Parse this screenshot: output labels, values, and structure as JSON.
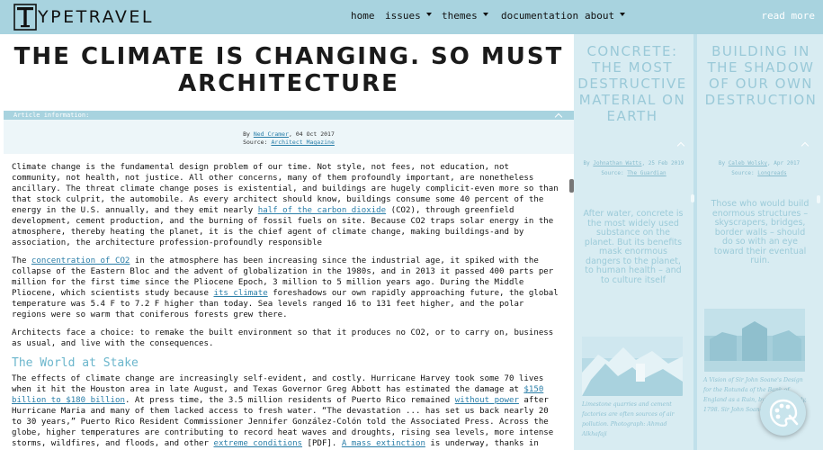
{
  "nav": {
    "brand_initial": "T",
    "brand_rest": "YPETRAVEL",
    "items": [
      {
        "label": "home",
        "dropdown": false
      },
      {
        "label": "issues",
        "dropdown": true
      },
      {
        "label": "themes",
        "dropdown": true
      },
      {
        "label": "documentation",
        "dropdown": false
      },
      {
        "label": "about",
        "dropdown": true
      }
    ],
    "read_more": "read more"
  },
  "article": {
    "title_line1": "THE CLIMATE IS CHANGING. SO MUST",
    "title_line2": "ARCHITECTURE",
    "info_label": "Article information:",
    "by_prefix": "By",
    "author": "Ned Cramer",
    "date": ", 04 Oct 2017",
    "source_prefix": "Source:",
    "source": "Architect Magazine",
    "p1": "Climate change is the fundamental design problem of our time. Not style, not fees, not education, not community, not health, not justice. All other concerns, many of them profoundly important, are nonetheless ancillary. The threat climate change poses is existential, and buildings are hugely complicit-even more so than that stock culprit, the automobile. As every architect should know, buildings consume some 40 percent of the energy in the U.S. annually, and they emit nearly",
    "p1_link": "half of the carbon dioxide",
    "p1_rest": " (CO2), through greenfield development, cement production, and the burning of fossil fuels on site. Because CO2 traps solar energy in the atmosphere, thereby heating the planet, it is the chief agent of climate change, making buildings-and by association, the architecture profession-profoundly responsible",
    "p2_start": "The ",
    "p2_link1": "concentration of CO2",
    "p2_mid": " in the atmosphere has been increasing since the industrial age, it spiked with the collapse of the Eastern Bloc and the advent of globalization in the 1980s, and in 2013 it passed 400 parts per million for the first time since the Pliocene Epoch, 3 million to 5 million years ago. During the Middle Pliocene, which scientists study because ",
    "p2_link2": "its climate",
    "p2_end": " foreshadows our own rapidly approaching future, the global temperature was 5.4 F to 7.2 F higher than today. Sea levels ranged 16 to 131 feet higher, and the polar regions were so warm that coniferous forests grew there.",
    "p3": "Architects face a choice: to remake the built environment so that it produces no CO2, or to carry on, business as usual, and live with the consequences.",
    "h2": "The World at Stake",
    "p4_start": "The effects of climate change are increasingly self-evident, and costly. Hurricane Harvey took some 70 lives when it hit the Houston area in late August, and Texas Governor Greg Abbott has estimated the damage at ",
    "p4_link1": "$150 billion to $180 billion",
    "p4_mid1": ". At press time, the 3.5 million residents of Puerto Rico remained ",
    "p4_link2": "without power",
    "p4_mid2": " after Hurricane Maria and many of them lacked access to fresh water. “The devastation ... has set us back nearly 20 to 30 years,” Puerto Rico Resident Commissioner Jennifer González-Colón told the Associated Press. Across the globe, higher temperatures are contributing to record heat waves and droughts, rising sea levels, more intense storms, wildfires, and floods, and other ",
    "p4_link3": "extreme conditions",
    "p4_mid3": " [PDF]. ",
    "p4_link4": "A mass extinction",
    "p4_end": " is underway, thanks in part"
  },
  "sidebar": {
    "cards": [
      {
        "title": "CONCRETE: THE MOST DESTRUCTIVE MATERIAL ON EARTH",
        "by_prefix": "By",
        "author": "Johnathan Watts",
        "date": ", 25 Feb 2019",
        "source_prefix": "Source:",
        "source": "The Guardian",
        "excerpt": "After water, concrete is the most widely used substance on the planet. But its benefits mask enormous dangers to the planet, to human health – and to culture itself",
        "caption": "Limestone quarries and cement factories are often sources of air pollution. Photograph: Ahmad Alkhafaji"
      },
      {
        "title": "BUILDING IN THE SHADOW OF OUR OWN DESTRUCTION",
        "by_prefix": "By",
        "author": "Caleb Wolsky",
        "date": ", Apr 2017",
        "source_prefix": "Source:",
        "source": "Longreads",
        "excerpt": "Those who would build enormous structures – skyscrapers, bridges, border walls – should do so with an eye toward their eventual ruin.",
        "caption": "A Vision of Sir John Soane's Design for the Rotunda of the Bank of England as a Ruin, by Joseph Gandy, 1798. Sir John Soane's Museum"
      }
    ]
  },
  "colors": {
    "nav_bg": "#a8d3df",
    "accent": "#6bb6cc",
    "link": "#2a7ea8"
  },
  "icons": {
    "palette": "palette-icon",
    "collapse": "chevron-up-icon",
    "dropdown": "caret-down-icon"
  }
}
